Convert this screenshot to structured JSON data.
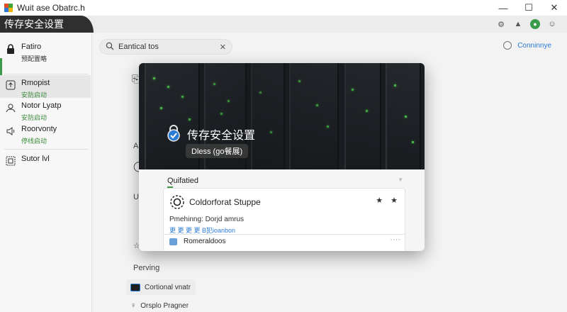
{
  "window": {
    "title": "Wuit ase Obatrc.h",
    "minimize": "—",
    "maximize": "☐",
    "close": "✕"
  },
  "header": {
    "tab_title": "传存安全设置",
    "icons": [
      "settings-icon",
      "bell-icon",
      "status-icon",
      "user-icon"
    ]
  },
  "sidebar": {
    "items": [
      {
        "title": "Fatiro",
        "sub": "预配置略",
        "icon": "lock-icon"
      },
      {
        "title": "Rmopist",
        "sub": "安防启动",
        "icon": "upload-box-icon"
      },
      {
        "title": "Notor Lyatp",
        "sub": "安防启动",
        "icon": "person-icon"
      },
      {
        "title": "Roorvonty",
        "sub": "停线启动",
        "icon": "speaker-icon"
      },
      {
        "title": "Sutor lvl",
        "sub": "",
        "icon": "grid-box-icon"
      }
    ]
  },
  "search": {
    "placeholder": "Eantical tos",
    "value": "Eantical tos"
  },
  "topright": {
    "label": "Conninnye"
  },
  "background": {
    "fragments": [
      "Ar",
      "UF",
      "Perving"
    ],
    "boxes": [
      "Cortional vnatr",
      "Orsplo Pragner"
    ]
  },
  "modal": {
    "hero_title": "传存安全设置",
    "hero_pill": "Dless (go餐展)",
    "section_label": "Quifatied",
    "card": {
      "title": "Coldorforat Stuppe",
      "stars": "★ ★",
      "desc": "Pmehinng: Dorjd amrus",
      "link": "更 更 更 更 B犯ioanbon",
      "row_text": "Romeraldoos",
      "more": "····"
    }
  },
  "colors": {
    "accent_green": "#3a9b4a",
    "link_blue": "#2b7bd6",
    "header_dark": "#2f2f2f"
  }
}
